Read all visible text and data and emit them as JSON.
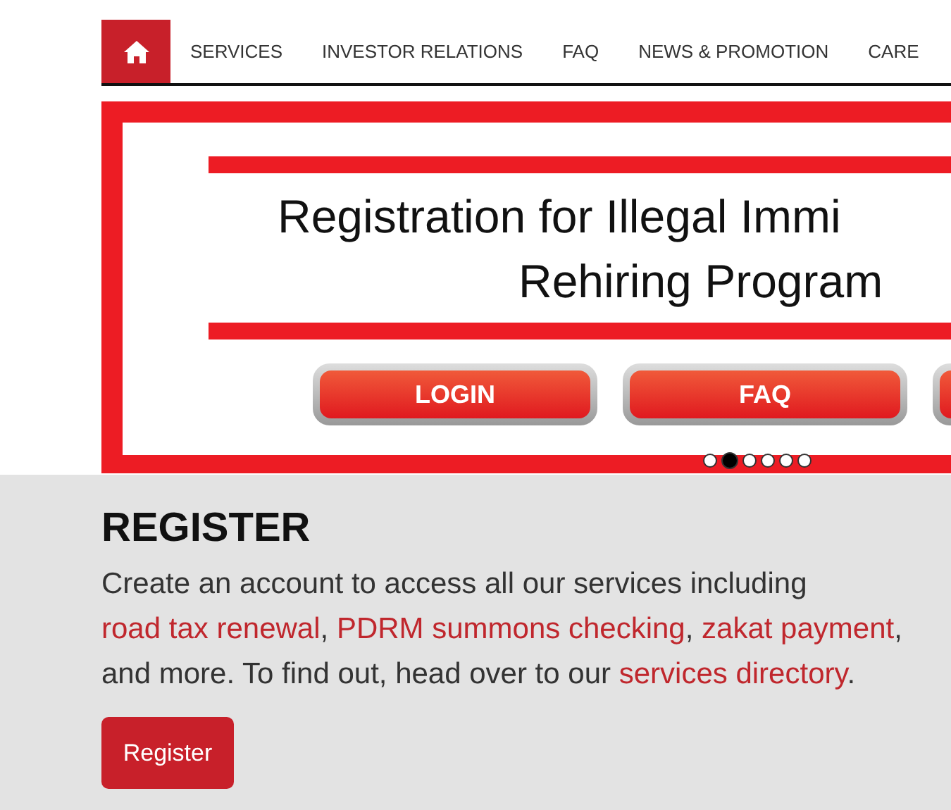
{
  "nav": {
    "items": [
      {
        "kind": "home",
        "selected": true
      },
      {
        "kind": "text",
        "label": "SERVICES",
        "selected": false
      },
      {
        "kind": "text",
        "label": "INVESTOR RELATIONS",
        "selected": false
      },
      {
        "kind": "text",
        "label": "FAQ",
        "selected": false
      },
      {
        "kind": "text",
        "label": "NEWS & PROMOTION",
        "selected": false
      },
      {
        "kind": "text",
        "label": "CARE",
        "selected": false
      }
    ]
  },
  "banner": {
    "title_lines": [
      "Registration for Illegal Immi",
      "Rehiring Program"
    ],
    "buttons": [
      {
        "label": "LOGIN"
      },
      {
        "label": "FAQ"
      }
    ],
    "dots": [
      {
        "selected": false
      },
      {
        "selected": true
      },
      {
        "selected": false
      },
      {
        "selected": false
      },
      {
        "selected": false
      },
      {
        "selected": false
      }
    ]
  },
  "register": {
    "heading": "REGISTER",
    "paragraph": [
      {
        "kind": "text",
        "text": "Create an account to access all our services including "
      },
      {
        "kind": "link",
        "text": "road tax renewal"
      },
      {
        "kind": "text",
        "text": ", "
      },
      {
        "kind": "link",
        "text": "PDRM summons checking"
      },
      {
        "kind": "text",
        "text": ", "
      },
      {
        "kind": "link",
        "text": "zakat payment"
      },
      {
        "kind": "text",
        "text": ", and more. To find out, head over to our "
      },
      {
        "kind": "link",
        "text": "services directory"
      },
      {
        "kind": "text",
        "text": "."
      }
    ],
    "button": "Register"
  }
}
